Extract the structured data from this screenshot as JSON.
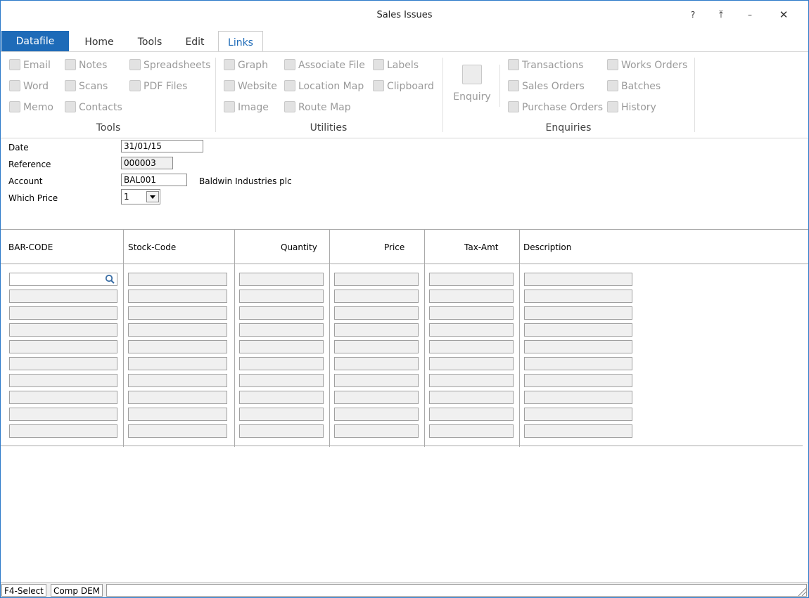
{
  "window": {
    "title": "Sales Issues",
    "help": "?",
    "restore": "⤒",
    "minimize": "–",
    "close": "✕"
  },
  "tabs": [
    {
      "label": "Datafile"
    },
    {
      "label": "Home"
    },
    {
      "label": "Tools"
    },
    {
      "label": "Edit"
    },
    {
      "label": "Links"
    }
  ],
  "ribbon": {
    "tools": {
      "label": "Tools",
      "items": [
        {
          "label": "Email"
        },
        {
          "label": "Notes"
        },
        {
          "label": "Spreadsheets"
        },
        {
          "label": "Word"
        },
        {
          "label": "Scans"
        },
        {
          "label": "PDF Files"
        },
        {
          "label": "Memo"
        },
        {
          "label": "Contacts"
        }
      ]
    },
    "utilities": {
      "label": "Utilities",
      "items": [
        {
          "label": "Graph"
        },
        {
          "label": "Associate File"
        },
        {
          "label": "Labels"
        },
        {
          "label": "Website"
        },
        {
          "label": "Location Map"
        },
        {
          "label": "Clipboard"
        },
        {
          "label": "Image"
        },
        {
          "label": "Route Map"
        }
      ]
    },
    "enquiry": {
      "label": "Enquiry"
    },
    "enquiries": {
      "label": "Enquiries",
      "items": [
        {
          "label": "Transactions"
        },
        {
          "label": "Works Orders"
        },
        {
          "label": "Sales Orders"
        },
        {
          "label": "Batches"
        },
        {
          "label": "Purchase Orders"
        },
        {
          "label": "History"
        }
      ]
    }
  },
  "form": {
    "date": {
      "label": "Date",
      "value": "31/01/15"
    },
    "reference": {
      "label": "Reference",
      "value": "000003"
    },
    "account": {
      "label": "Account",
      "value": "BAL001",
      "name": "Baldwin Industries plc"
    },
    "which_price": {
      "label": "Which Price",
      "value": "1"
    }
  },
  "grid": {
    "columns": [
      {
        "label": "BAR-CODE"
      },
      {
        "label": "Stock-Code"
      },
      {
        "label": "Quantity"
      },
      {
        "label": "Price"
      },
      {
        "label": "Tax-Amt"
      },
      {
        "label": "Description"
      }
    ],
    "row_count": 10
  },
  "status": {
    "f4": "F4-Select",
    "company": "Comp DEM"
  }
}
